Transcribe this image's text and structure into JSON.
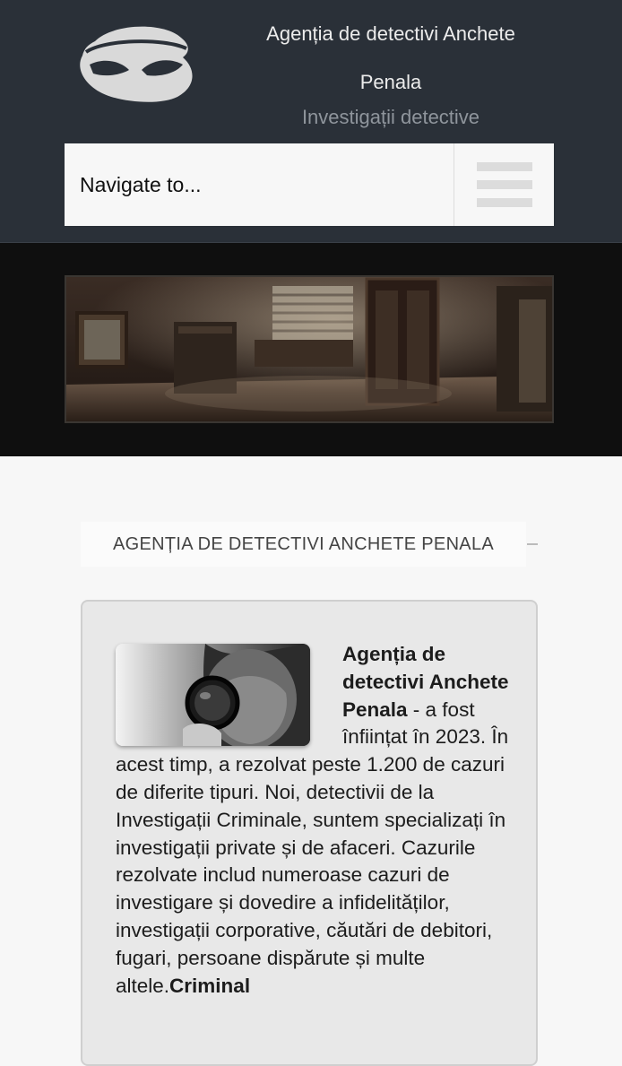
{
  "header": {
    "title": "Agenția de detectivi Anchete Penala",
    "tagline": "Investigații detective",
    "nav_placeholder": "Navigate to...",
    "menu_icon": "hamburger-menu-icon",
    "logo_icon": "mask-logo-icon"
  },
  "colors": {
    "header_bg": "#2a3038",
    "banner_bg": "#0f0f0f",
    "page_bg": "#f7f7f7",
    "card_bg": "#e8e8e8"
  },
  "main": {
    "section_heading": "AGENȚIA DE DETECTIVI ANCHETE PENALA",
    "intro_bold": "Agenția de detectivi Anchete Penala",
    "intro_text": " - a fost înființat în 2023. În acest timp, a rezolvat peste 1.200 de cazuri de diferite tipuri. Noi, detectivii de la Investigații Criminale, suntem specializați în investigații private și de afaceri. Cazurile rezolvate includ numeroase cazuri de investigare și dovedire a infidelităților, investigații corporative, căutări de debitori, fugari, persoane dispărute și multe altele.",
    "trailing_bold": "Criminal"
  }
}
